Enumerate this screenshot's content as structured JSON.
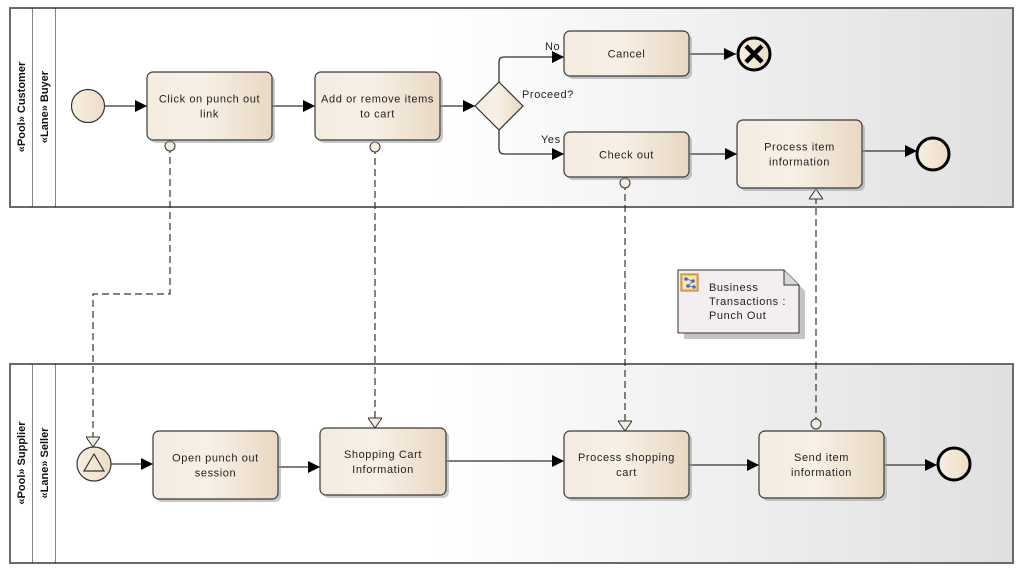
{
  "pools": [
    {
      "id": "customer",
      "pool_label": "«Pool» Customer",
      "lane_label": "«Lane» Buyer"
    },
    {
      "id": "supplier",
      "pool_label": "«Pool» Supplier",
      "lane_label": "«Lane» Seller"
    }
  ],
  "tasks": {
    "click_punch_out": [
      "Click on punch out",
      "link"
    ],
    "add_remove_items": [
      "Add or remove items",
      "to cart"
    ],
    "cancel": [
      "Cancel"
    ],
    "check_out": [
      "Check out"
    ],
    "process_item_info": [
      "Process item",
      "information"
    ],
    "open_punch_out": [
      "Open punch out",
      "session"
    ],
    "shopping_cart_info": [
      "Shopping Cart",
      "Information"
    ],
    "process_shopping_cart": [
      "Process shopping",
      "cart"
    ],
    "send_item_info": [
      "Send item",
      "information"
    ]
  },
  "gateway": {
    "label": "Proceed?",
    "yes_label": "Yes",
    "no_label": "No"
  },
  "note": {
    "icon": "business-process-icon",
    "lines": [
      "Business",
      "Transactions :",
      "Punch Out"
    ]
  },
  "events": {
    "buyer_start": "start-event",
    "buyer_cancel_end": "cancel-end-event",
    "buyer_end": "end-event",
    "seller_start": "message-start-event",
    "seller_end": "end-event"
  },
  "colors": {
    "task_fill_light": "#f7efe3",
    "task_fill_dark": "#eadbc5",
    "pool_border": "#6a6a6a",
    "pool_gradient_end": "#e2e2e2",
    "note_fill": "#f4eef3"
  }
}
